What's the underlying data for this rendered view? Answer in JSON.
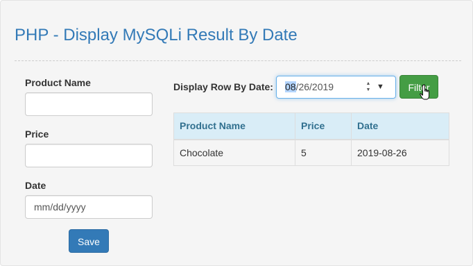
{
  "page": {
    "title": "PHP - Display MySQLi Result By Date"
  },
  "form": {
    "product_name_label": "Product Name",
    "product_name_value": "",
    "price_label": "Price",
    "price_value": "",
    "date_label": "Date",
    "date_placeholder": "mm/dd/yyyy",
    "save_label": "Save"
  },
  "filter": {
    "label": "Display Row By Date:",
    "date_mm": "08",
    "date_rest": "/26/2019",
    "button_label": "Filter"
  },
  "table": {
    "headers": [
      "Product Name",
      "Price",
      "Date"
    ],
    "rows": [
      [
        "Chocolate",
        "5",
        "2019-08-26"
      ]
    ]
  },
  "colors": {
    "title": "#337ab7",
    "save_button": "#337ab7",
    "filter_button": "#449d44",
    "table_header_bg": "#d9edf7",
    "table_header_text": "#31708f"
  },
  "icons": {
    "cursor": "hand-pointer-icon",
    "spinner": "up-down-spinner-icon",
    "dropdown": "caret-down-icon"
  }
}
